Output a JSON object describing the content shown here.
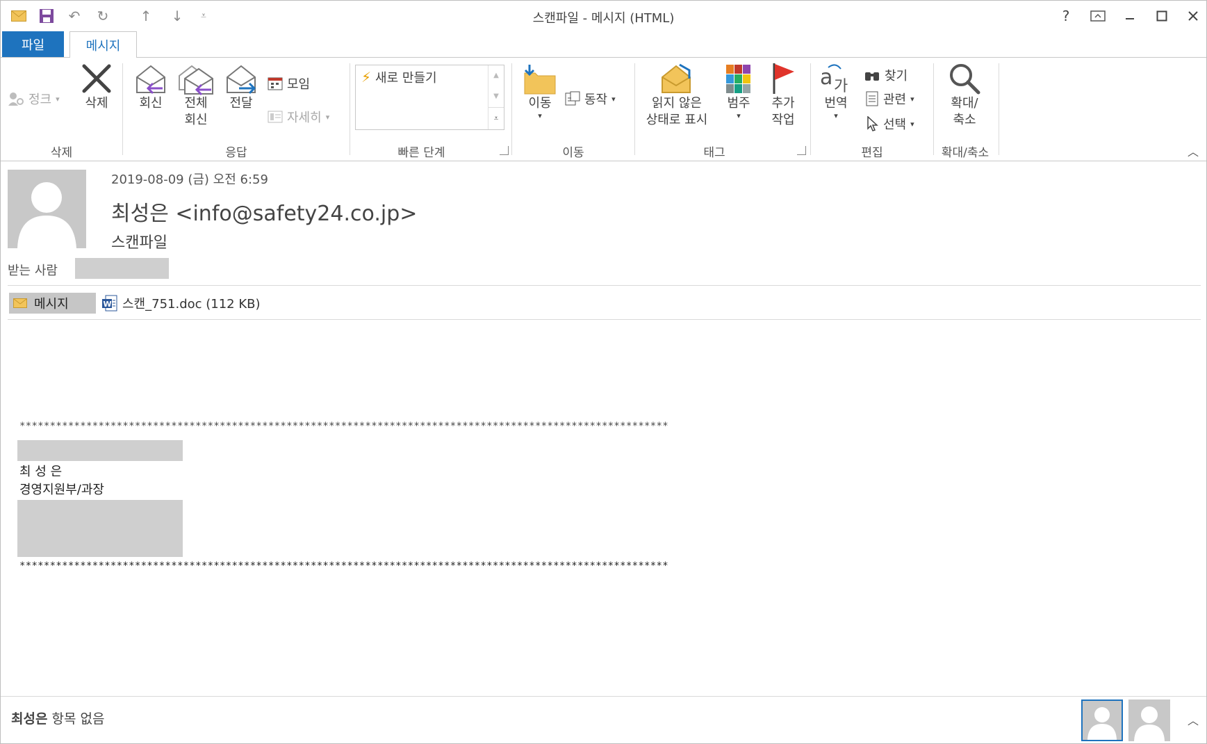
{
  "window": {
    "title": "스캔파일 - 메시지 (HTML)",
    "qat_icons": [
      "envelope-icon",
      "save-icon",
      "undo-icon",
      "redo-icon",
      "up-arrow-icon",
      "down-arrow-icon",
      "customize-dropdown-icon"
    ],
    "controls": {
      "help": "?"
    }
  },
  "tabs": {
    "file": "파일",
    "message": "메시지"
  },
  "ribbon": {
    "delete_group": {
      "label": "삭제",
      "junk": "정크",
      "delete": "삭제"
    },
    "respond_group": {
      "label": "응답",
      "reply": "회신",
      "reply_all": "전체\n회신",
      "forward": "전달",
      "meeting": "모임",
      "more": "자세히"
    },
    "quick_steps_group": {
      "label": "빠른 단계",
      "new": "새로 만들기"
    },
    "move_group": {
      "label": "이동",
      "move": "이동",
      "actions": "동작"
    },
    "tags_group": {
      "label": "태그",
      "mark_unread": "읽지 않은\n상태로 표시",
      "categorize": "범주",
      "follow_up": "추가\n작업"
    },
    "editing_group": {
      "label": "편집",
      "translate": "번역",
      "find": "찾기",
      "related": "관련",
      "select": "선택"
    },
    "zoom_group": {
      "label": "확대/축소",
      "zoom": "확대/\n축소"
    }
  },
  "header": {
    "date": "2019-08-09 (금) 오전 6:59",
    "sender": "최성은 <info@safety24.co.jp>",
    "subject": "스캔파일",
    "to_label": "받는 사람"
  },
  "attachments": {
    "message_tab": "메시지",
    "file": "스캔_751.doc (112 KB)"
  },
  "body": {
    "stars_top": "***********************************************************************************************************",
    "name": "최 성 은",
    "dept": "경영지원부/과장",
    "stars_bottom": "***********************************************************************************************************"
  },
  "footer": {
    "person": "최성은",
    "status": "항목 없음"
  },
  "colors": {
    "accent": "#1e73be",
    "flag": "#e0342b",
    "arrow_purple": "#8a4fc9"
  }
}
